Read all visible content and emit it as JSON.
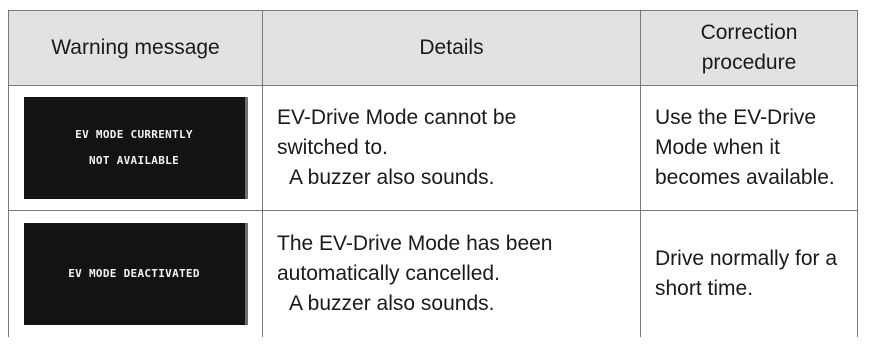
{
  "table": {
    "headers": {
      "warning_message": "Warning message",
      "details": "Details",
      "correction_line1": "Correction",
      "correction_line2": "procedure"
    },
    "rows": [
      {
        "screen_line1": "EV MODE CURRENTLY",
        "screen_line2": "NOT AVAILABLE",
        "details_line1": "EV-Drive Mode cannot be",
        "details_line2": "switched to.",
        "details_line3": "A buzzer also sounds.",
        "correction_line1": "Use the EV-Drive",
        "correction_line2": "Mode when it",
        "correction_line3": "becomes available."
      },
      {
        "screen_line1": "EV MODE DEACTIVATED",
        "details_line1": "The EV-Drive Mode has been",
        "details_line2": "automatically cancelled.",
        "details_line3": "A buzzer also sounds.",
        "correction_line1": "Drive normally for a",
        "correction_line2": "short time."
      }
    ]
  },
  "colors": {
    "header_background": "#e2e2e2",
    "screen_background": "#131313",
    "screen_text": "#f2f2f2",
    "border": "#7a7a7a"
  }
}
